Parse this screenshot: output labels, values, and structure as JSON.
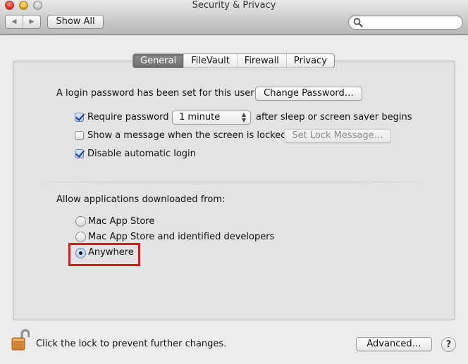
{
  "window": {
    "title": "Security & Privacy",
    "traffic_lights": [
      "close",
      "minimize",
      "zoom"
    ]
  },
  "toolbar": {
    "back_icon": "◀",
    "forward_icon": "▶",
    "show_all_label": "Show All",
    "search": {
      "value": "",
      "placeholder": ""
    }
  },
  "tabs": [
    {
      "label": "General",
      "active": true
    },
    {
      "label": "FileVault",
      "active": false
    },
    {
      "label": "Firewall",
      "active": false
    },
    {
      "label": "Privacy",
      "active": false
    }
  ],
  "general": {
    "login_password_text": "A login password has been set for this user",
    "change_password_label": "Change Password…",
    "require_password": {
      "label": "Require password",
      "checked": true,
      "popup_value": "1 minute",
      "suffix": "after sleep or screen saver begins"
    },
    "show_message": {
      "label": "Show a message when the screen is locked",
      "checked": false,
      "button_label": "Set Lock Message…",
      "button_enabled": false
    },
    "disable_auto_login": {
      "label": "Disable automatic login",
      "checked": true
    },
    "allow_apps_heading": "Allow applications downloaded from:",
    "allow_apps_options": [
      {
        "label": "Mac App Store",
        "selected": false
      },
      {
        "label": "Mac App Store and identified developers",
        "selected": false
      },
      {
        "label": "Anywhere",
        "selected": true
      }
    ],
    "highlight_color": "#e0141f"
  },
  "footer": {
    "lock_text": "Click the lock to prevent further changes.",
    "lock_state": "unlocked",
    "advanced_label": "Advanced…",
    "help_label": "?"
  }
}
